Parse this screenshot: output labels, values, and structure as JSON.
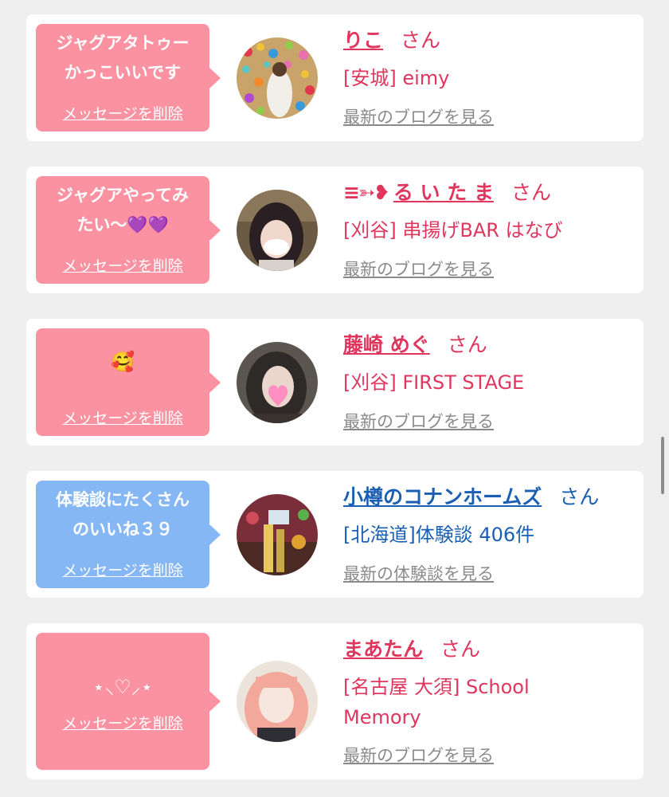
{
  "cards": [
    {
      "message": "ジャグアタトゥー\nかっこいいです",
      "delete_label": "メッセージを削除",
      "name": "りこ",
      "honorific": "さん",
      "shop": "[安城] eimy",
      "link": "最新のブログを見る",
      "color": "#fb92a2"
    },
    {
      "message": "ジャグアやってみ\nたい〜💜💜",
      "delete_label": "メッセージを削除",
      "name_prefix": "≡➳❥",
      "name": "る い た ま",
      "honorific": "さん",
      "shop": "[刈谷] 串揚げBAR はなび",
      "link": "最新のブログを見る",
      "color": "#fb92a2"
    },
    {
      "message": "🥰",
      "delete_label": "メッセージを削除",
      "name": "藤崎 めぐ",
      "honorific": "さん",
      "shop": "[刈谷] FIRST STAGE",
      "link": "最新のブログを見る",
      "color": "#fb92a2"
    },
    {
      "message": "体験談にたくさん\nのいいね３９",
      "delete_label": "メッセージを削除",
      "name": "小樽のコナンホームズ",
      "honorific": "さん",
      "shop": "[北海道]体験談 406件",
      "link": "最新の体験談を見る",
      "color": "#86b7f5"
    },
    {
      "message": "⋆⸜♡⸝⋆",
      "delete_label": "メッセージを削除",
      "name": "まあたん",
      "honorific": "さん",
      "shop": "[名古屋 大須] School\nMemory",
      "link": "最新のブログを見る",
      "color": "#fb92a2"
    }
  ],
  "icons": {
    "avatar": "avatar-photo",
    "bubble_pointer": "speech-bubble-tail"
  }
}
